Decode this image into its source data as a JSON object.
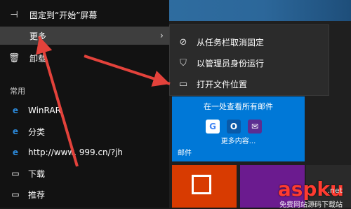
{
  "colors": {
    "tile_blue": "#0078d7",
    "tile_red": "#d83b01",
    "tile_purple": "#6b1b8f",
    "arrow_red": "#e3423b",
    "watermark": "#ff3b30"
  },
  "context_menu": {
    "items": [
      {
        "label": "固定到“开始”屏幕",
        "icon": "pin-icon"
      },
      {
        "label": "更多",
        "icon": "more-icon",
        "chevron": "›"
      },
      {
        "label": "卸载",
        "icon": "trash-icon"
      }
    ]
  },
  "start_list": {
    "section": "常用",
    "apps": [
      {
        "label": "WinRAR",
        "icon": "ie-icon"
      },
      {
        "label": "分类",
        "icon": "ie-icon"
      },
      {
        "label": "http://www.  999.cn/?jh",
        "icon": "ie-icon"
      },
      {
        "label": "下载",
        "icon": "file-icon"
      },
      {
        "label": "推荐",
        "icon": "file-icon"
      }
    ]
  },
  "submenu": {
    "items": [
      {
        "label": "从任务栏取消固定",
        "icon": "unpin-icon"
      },
      {
        "label": "以管理员身份运行",
        "icon": "shield-icon"
      },
      {
        "label": "打开文件位置",
        "icon": "file-icon"
      }
    ]
  },
  "mail_tile": {
    "title": "在一处查看所有邮件",
    "more": "更多内容...",
    "label": "邮件",
    "icons": [
      "G",
      "O",
      "✉"
    ]
  },
  "watermark": {
    "main": "aspku",
    "net": ".net",
    "sub": "免费网站源码下载站"
  }
}
